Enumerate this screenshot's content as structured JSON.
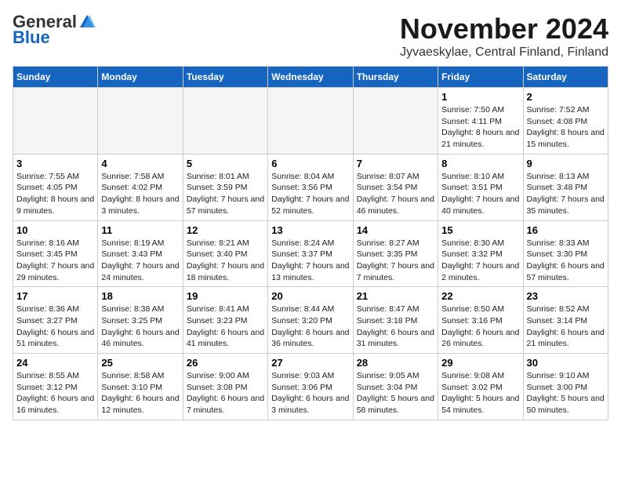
{
  "header": {
    "logo_general": "General",
    "logo_blue": "Blue",
    "month_title": "November 2024",
    "location": "Jyvaeskylae, Central Finland, Finland"
  },
  "weekdays": [
    "Sunday",
    "Monday",
    "Tuesday",
    "Wednesday",
    "Thursday",
    "Friday",
    "Saturday"
  ],
  "weeks": [
    [
      {
        "day": "",
        "info": ""
      },
      {
        "day": "",
        "info": ""
      },
      {
        "day": "",
        "info": ""
      },
      {
        "day": "",
        "info": ""
      },
      {
        "day": "",
        "info": ""
      },
      {
        "day": "1",
        "info": "Sunrise: 7:50 AM\nSunset: 4:11 PM\nDaylight: 8 hours and 21 minutes."
      },
      {
        "day": "2",
        "info": "Sunrise: 7:52 AM\nSunset: 4:08 PM\nDaylight: 8 hours and 15 minutes."
      }
    ],
    [
      {
        "day": "3",
        "info": "Sunrise: 7:55 AM\nSunset: 4:05 PM\nDaylight: 8 hours and 9 minutes."
      },
      {
        "day": "4",
        "info": "Sunrise: 7:58 AM\nSunset: 4:02 PM\nDaylight: 8 hours and 3 minutes."
      },
      {
        "day": "5",
        "info": "Sunrise: 8:01 AM\nSunset: 3:59 PM\nDaylight: 7 hours and 57 minutes."
      },
      {
        "day": "6",
        "info": "Sunrise: 8:04 AM\nSunset: 3:56 PM\nDaylight: 7 hours and 52 minutes."
      },
      {
        "day": "7",
        "info": "Sunrise: 8:07 AM\nSunset: 3:54 PM\nDaylight: 7 hours and 46 minutes."
      },
      {
        "day": "8",
        "info": "Sunrise: 8:10 AM\nSunset: 3:51 PM\nDaylight: 7 hours and 40 minutes."
      },
      {
        "day": "9",
        "info": "Sunrise: 8:13 AM\nSunset: 3:48 PM\nDaylight: 7 hours and 35 minutes."
      }
    ],
    [
      {
        "day": "10",
        "info": "Sunrise: 8:16 AM\nSunset: 3:45 PM\nDaylight: 7 hours and 29 minutes."
      },
      {
        "day": "11",
        "info": "Sunrise: 8:19 AM\nSunset: 3:43 PM\nDaylight: 7 hours and 24 minutes."
      },
      {
        "day": "12",
        "info": "Sunrise: 8:21 AM\nSunset: 3:40 PM\nDaylight: 7 hours and 18 minutes."
      },
      {
        "day": "13",
        "info": "Sunrise: 8:24 AM\nSunset: 3:37 PM\nDaylight: 7 hours and 13 minutes."
      },
      {
        "day": "14",
        "info": "Sunrise: 8:27 AM\nSunset: 3:35 PM\nDaylight: 7 hours and 7 minutes."
      },
      {
        "day": "15",
        "info": "Sunrise: 8:30 AM\nSunset: 3:32 PM\nDaylight: 7 hours and 2 minutes."
      },
      {
        "day": "16",
        "info": "Sunrise: 8:33 AM\nSunset: 3:30 PM\nDaylight: 6 hours and 57 minutes."
      }
    ],
    [
      {
        "day": "17",
        "info": "Sunrise: 8:36 AM\nSunset: 3:27 PM\nDaylight: 6 hours and 51 minutes."
      },
      {
        "day": "18",
        "info": "Sunrise: 8:38 AM\nSunset: 3:25 PM\nDaylight: 6 hours and 46 minutes."
      },
      {
        "day": "19",
        "info": "Sunrise: 8:41 AM\nSunset: 3:23 PM\nDaylight: 6 hours and 41 minutes."
      },
      {
        "day": "20",
        "info": "Sunrise: 8:44 AM\nSunset: 3:20 PM\nDaylight: 6 hours and 36 minutes."
      },
      {
        "day": "21",
        "info": "Sunrise: 8:47 AM\nSunset: 3:18 PM\nDaylight: 6 hours and 31 minutes."
      },
      {
        "day": "22",
        "info": "Sunrise: 8:50 AM\nSunset: 3:16 PM\nDaylight: 6 hours and 26 minutes."
      },
      {
        "day": "23",
        "info": "Sunrise: 8:52 AM\nSunset: 3:14 PM\nDaylight: 6 hours and 21 minutes."
      }
    ],
    [
      {
        "day": "24",
        "info": "Sunrise: 8:55 AM\nSunset: 3:12 PM\nDaylight: 6 hours and 16 minutes."
      },
      {
        "day": "25",
        "info": "Sunrise: 8:58 AM\nSunset: 3:10 PM\nDaylight: 6 hours and 12 minutes."
      },
      {
        "day": "26",
        "info": "Sunrise: 9:00 AM\nSunset: 3:08 PM\nDaylight: 6 hours and 7 minutes."
      },
      {
        "day": "27",
        "info": "Sunrise: 9:03 AM\nSunset: 3:06 PM\nDaylight: 6 hours and 3 minutes."
      },
      {
        "day": "28",
        "info": "Sunrise: 9:05 AM\nSunset: 3:04 PM\nDaylight: 5 hours and 58 minutes."
      },
      {
        "day": "29",
        "info": "Sunrise: 9:08 AM\nSunset: 3:02 PM\nDaylight: 5 hours and 54 minutes."
      },
      {
        "day": "30",
        "info": "Sunrise: 9:10 AM\nSunset: 3:00 PM\nDaylight: 5 hours and 50 minutes."
      }
    ]
  ]
}
